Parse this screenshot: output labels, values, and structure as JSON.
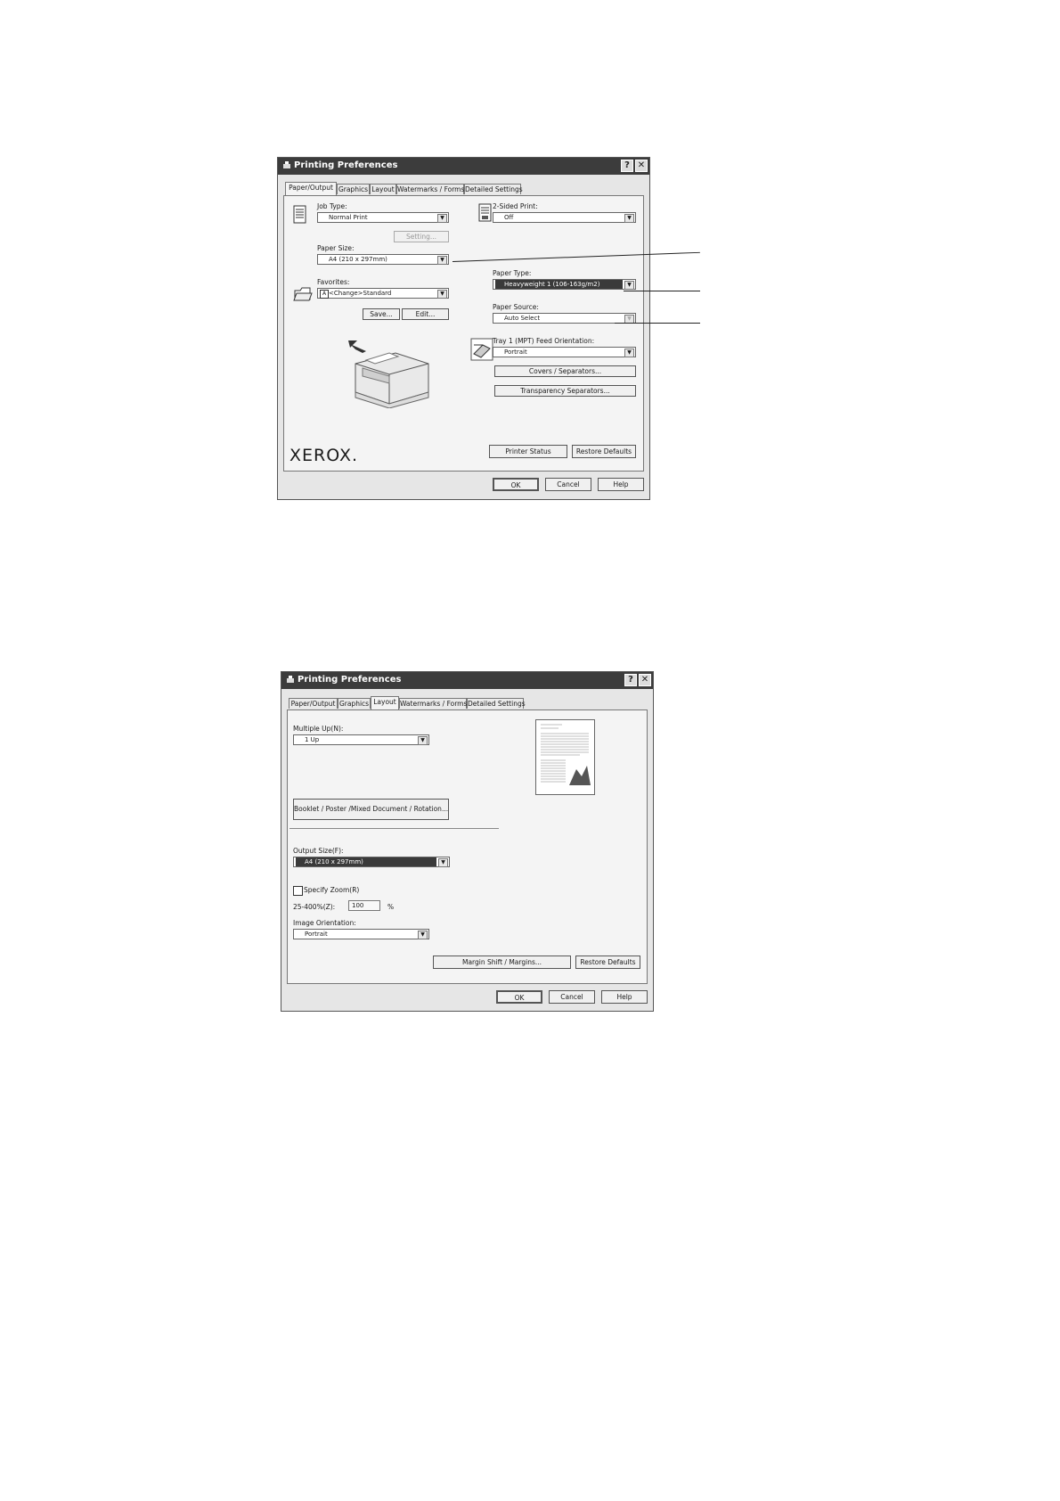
{
  "dialog1": {
    "title": "Printing Preferences",
    "tabs": [
      "Paper/Output",
      "Graphics",
      "Layout",
      "Watermarks / Forms",
      "Detailed Settings"
    ],
    "job_type_label": "Job Type:",
    "job_type_value": "Normal Print",
    "setting_button": "Setting...",
    "paper_size_label": "Paper Size:",
    "paper_size_value": "A4 (210 x 297mm)",
    "favorites_label": "Favorites:",
    "favorites_value": "<Change>Standard",
    "save_button": "Save...",
    "edit_button": "Edit...",
    "two_sided_label": "2-Sided Print:",
    "two_sided_value": "Off",
    "paper_type_label": "Paper Type:",
    "paper_type_value": "Heavyweight 1 (106-163g/m2)",
    "paper_source_label": "Paper Source:",
    "paper_source_value": "Auto Select",
    "tray_label": "Tray 1 (MPT) Feed Orientation:",
    "tray_value": "Portrait",
    "covers_button": "Covers / Separators...",
    "transparency_button": "Transparency Separators...",
    "brand": "XEROX.",
    "printer_status_button": "Printer Status",
    "restore_defaults_button": "Restore Defaults",
    "ok_button": "OK",
    "cancel_button": "Cancel",
    "help_button": "Help"
  },
  "dialog2": {
    "title": "Printing Preferences",
    "tabs": [
      "Paper/Output",
      "Graphics",
      "Layout",
      "Watermarks / Forms",
      "Detailed Settings"
    ],
    "multiple_up_label": "Multiple Up(N):",
    "multiple_up_value": "1 Up",
    "booklet_button": "Booklet / Poster /Mixed Document / Rotation...",
    "output_size_label": "Output Size(F):",
    "output_size_value": "A4 (210 x 297mm)",
    "specify_zoom_label": "Specify Zoom(R)",
    "zoom_range_label": "25-400%(Z):",
    "zoom_value": "100",
    "zoom_unit": "%",
    "orientation_label": "Image Orientation:",
    "orientation_value": "Portrait",
    "margin_shift_button": "Margin Shift / Margins...",
    "restore_defaults_button": "Restore Defaults",
    "ok_button": "OK",
    "cancel_button": "Cancel",
    "help_button": "Help"
  }
}
